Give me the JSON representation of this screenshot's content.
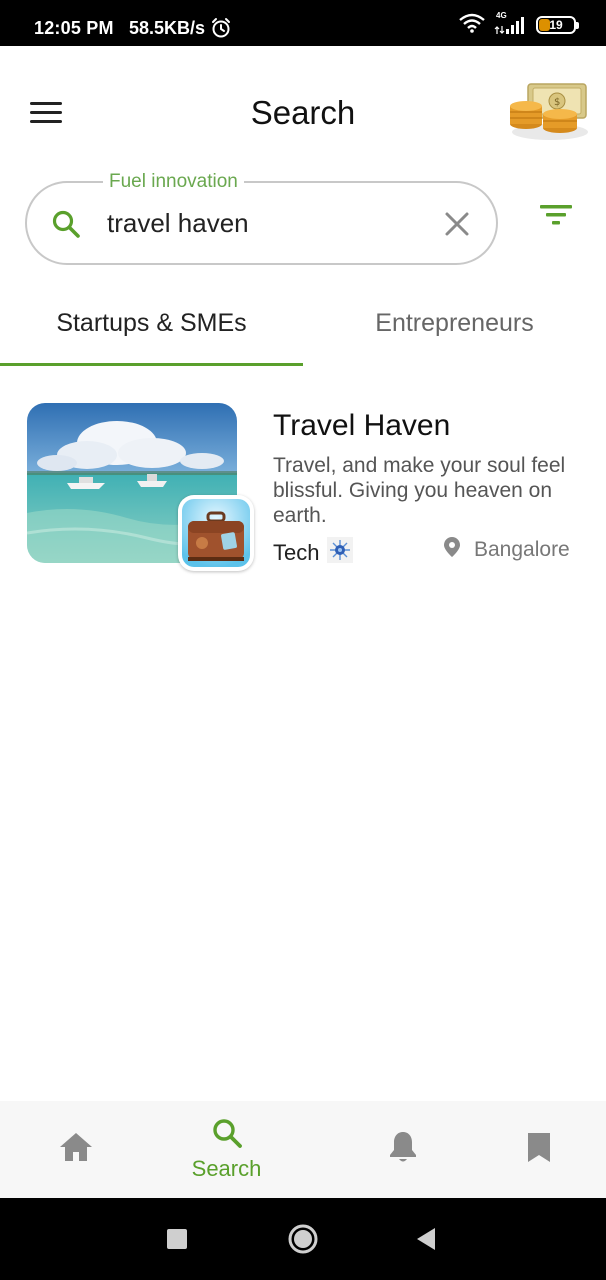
{
  "status_bar": {
    "time": "12:05 PM",
    "speed": "58.5KB/s",
    "network": "4G",
    "battery": "19"
  },
  "header": {
    "title": "Search",
    "menu_icon": "hamburger-menu-icon",
    "coins_icon": "coins-money-icon"
  },
  "search": {
    "legend": "Fuel innovation",
    "value": "travel haven",
    "placeholder": "",
    "accent": "#5aa02c"
  },
  "tabs": [
    {
      "label": "Startups & SMEs",
      "active": true
    },
    {
      "label": "Entrepreneurs",
      "active": false
    }
  ],
  "results": [
    {
      "title": "Travel Haven",
      "description": "Travel, and make your soul feel blissful. Giving you heaven on earth.",
      "category": "Tech",
      "location": "Bangalore"
    }
  ],
  "bottom_nav": {
    "items": [
      {
        "icon": "home-icon",
        "label": ""
      },
      {
        "icon": "search-icon",
        "label": "Search",
        "active": true
      },
      {
        "icon": "bell-icon",
        "label": ""
      },
      {
        "icon": "bookmark-icon",
        "label": ""
      }
    ]
  },
  "colors": {
    "accent_green": "#5aa02c",
    "legend_green": "#6aa84f",
    "icon_grey": "#8a8a8a"
  }
}
